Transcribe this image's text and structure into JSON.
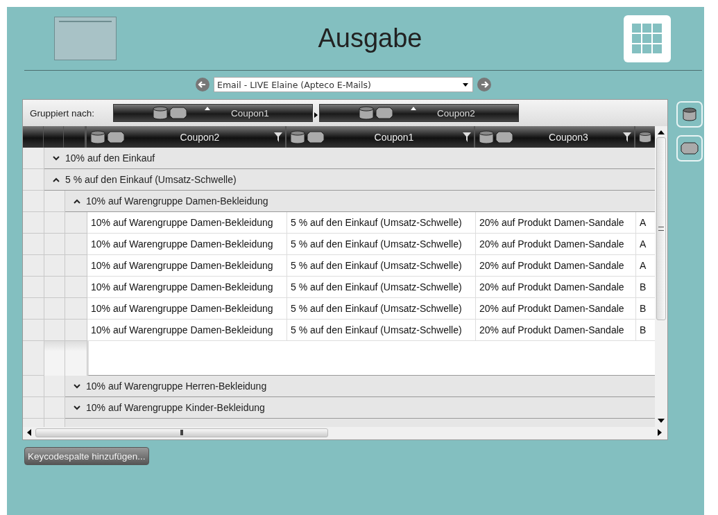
{
  "header": {
    "title": "Ausgabe"
  },
  "navigator": {
    "selection": "Email - LIVE Elaine (Apteco E-Mails)"
  },
  "group_bar": {
    "label": "Gruppiert nach:",
    "groups": [
      {
        "label": "Coupon1"
      },
      {
        "label": "Coupon2"
      }
    ]
  },
  "table": {
    "columns": [
      {
        "label": "Coupon2"
      },
      {
        "label": "Coupon1"
      },
      {
        "label": "Coupon3"
      }
    ],
    "groups": [
      {
        "label": "10% auf den Einkauf",
        "expanded": false
      },
      {
        "label": "5 % auf den Einkauf (Umsatz-Schwelle)",
        "expanded": true,
        "children": [
          {
            "label": "10% auf Warengruppe Damen-Bekleidung",
            "expanded": true,
            "rows": [
              [
                "10% auf Warengruppe Damen-Bekleidung",
                "5 % auf den Einkauf (Umsatz-Schwelle)",
                "20% auf Produkt Damen-Sandale",
                "A"
              ],
              [
                "10% auf Warengruppe Damen-Bekleidung",
                "5 % auf den Einkauf (Umsatz-Schwelle)",
                "20% auf Produkt Damen-Sandale",
                "A"
              ],
              [
                "10% auf Warengruppe Damen-Bekleidung",
                "5 % auf den Einkauf (Umsatz-Schwelle)",
                "20% auf Produkt Damen-Sandale",
                "A"
              ],
              [
                "10% auf Warengruppe Damen-Bekleidung",
                "5 % auf den Einkauf (Umsatz-Schwelle)",
                "20% auf Produkt Damen-Sandale",
                "B"
              ],
              [
                "10% auf Warengruppe Damen-Bekleidung",
                "5 % auf den Einkauf (Umsatz-Schwelle)",
                "20% auf Produkt Damen-Sandale",
                "B"
              ],
              [
                "10% auf Warengruppe Damen-Bekleidung",
                "5 % auf den Einkauf (Umsatz-Schwelle)",
                "20% auf Produkt Damen-Sandale",
                "B"
              ]
            ]
          },
          {
            "label": "10% auf Warengruppe Herren-Bekleidung",
            "expanded": false
          },
          {
            "label": "10% auf Warengruppe Kinder-Bekleidung",
            "expanded": false
          }
        ]
      }
    ]
  },
  "add_button": {
    "label": "Keycodespalte hinzufügen..."
  }
}
